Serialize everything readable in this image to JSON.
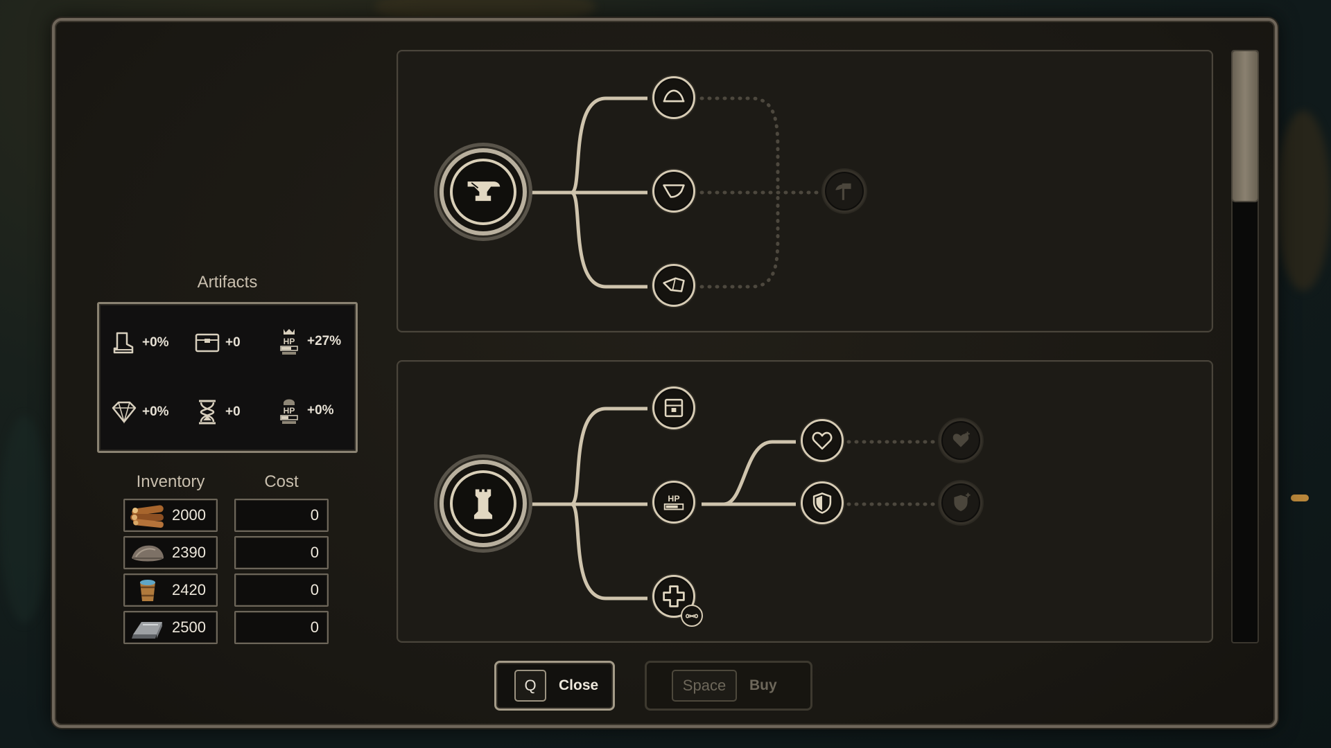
{
  "artifacts": {
    "title": "Artifacts",
    "items": [
      {
        "icon": "boot-icon",
        "value": "+0%"
      },
      {
        "icon": "chest-icon",
        "value": "+0"
      },
      {
        "icon": "hp-tower-icon",
        "value": "+27%"
      },
      {
        "icon": "diamond-icon",
        "value": "+0%"
      },
      {
        "icon": "hourglass-icon",
        "value": "+0"
      },
      {
        "icon": "hp-keep-icon",
        "value": "+0%"
      }
    ]
  },
  "inventory": {
    "title": "Inventory",
    "items": [
      {
        "icon": "wood-logs-icon",
        "amount": "2000"
      },
      {
        "icon": "stone-icon",
        "amount": "2390"
      },
      {
        "icon": "water-bucket-icon",
        "amount": "2420"
      },
      {
        "icon": "iron-ingot-icon",
        "amount": "2500"
      }
    ]
  },
  "cost": {
    "title": "Cost",
    "values": [
      "0",
      "0",
      "0",
      "0"
    ]
  },
  "trees": [
    {
      "root_icon": "anvil-icon",
      "nodes": [
        "helmet-icon",
        "chest-armor-icon",
        "gauntlet-icon",
        "axe-hammer-icon"
      ],
      "states": [
        "active",
        "active",
        "active",
        "locked"
      ]
    },
    {
      "root_icon": "rook-tower-icon",
      "nodes": [
        "storage-chest-icon",
        "hp-bar-icon",
        "heal-infinite-icon",
        "heart-icon",
        "shield-icon",
        "heart-plus-icon",
        "shield-plus-icon"
      ],
      "states": [
        "active",
        "active",
        "active",
        "active",
        "active",
        "locked",
        "locked"
      ]
    }
  ],
  "buttons": {
    "close_key": "Q",
    "close_label": "Close",
    "buy_key": "Space",
    "buy_label": "Buy"
  },
  "colors": {
    "accent": "#d6cbb4",
    "panel": "#1c1a15",
    "locked": "#353129"
  }
}
